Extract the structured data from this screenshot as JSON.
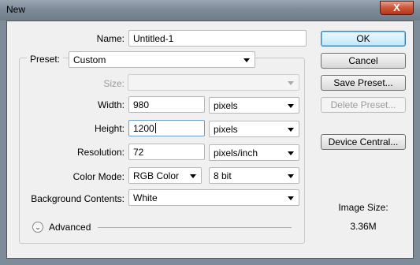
{
  "window": {
    "title": "New",
    "close_glyph": "X"
  },
  "form": {
    "name_label": "Name:",
    "name_value": "Untitled-1",
    "preset_label": "Preset:",
    "preset_value": "Custom",
    "size_label": "Size:",
    "size_value": "",
    "width_label": "Width:",
    "width_value": "980",
    "width_unit": "pixels",
    "height_label": "Height:",
    "height_value": "1200",
    "height_unit": "pixels",
    "resolution_label": "Resolution:",
    "resolution_value": "72",
    "resolution_unit": "pixels/inch",
    "color_mode_label": "Color Mode:",
    "color_mode_value": "RGB Color",
    "bit_depth_value": "8 bit",
    "background_label": "Background Contents:",
    "background_value": "White",
    "advanced_label": "Advanced"
  },
  "buttons": {
    "ok": "OK",
    "cancel": "Cancel",
    "save_preset": "Save Preset...",
    "delete_preset": "Delete Preset...",
    "device_central": "Device Central..."
  },
  "image_size": {
    "label": "Image Size:",
    "value": "3.36M"
  },
  "icons": {
    "advanced_toggle": "double-chevron-down-icon",
    "dropdown": "chevron-down-icon"
  }
}
